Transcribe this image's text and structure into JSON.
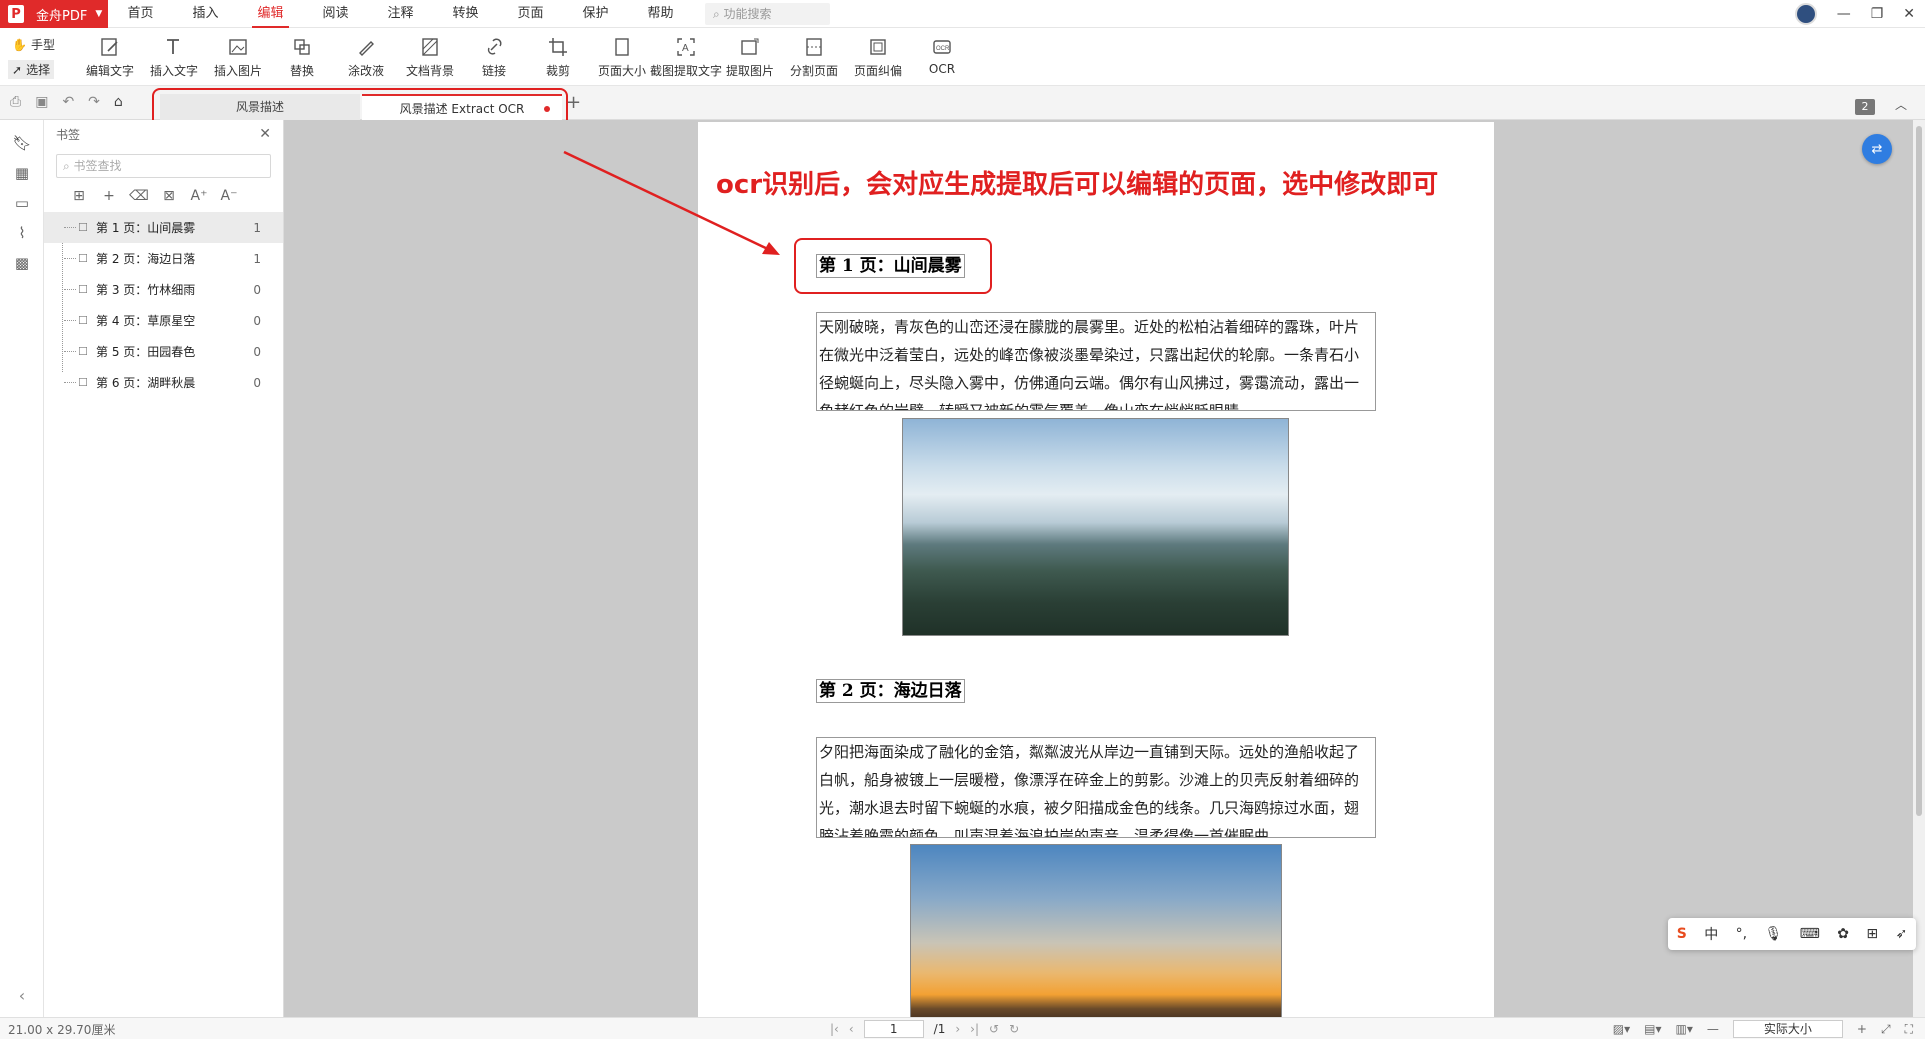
{
  "app": {
    "brand": "金舟PDF"
  },
  "menu": [
    "首页",
    "插入",
    "编辑",
    "阅读",
    "注释",
    "转换",
    "页面",
    "保护",
    "帮助"
  ],
  "menu_active": "编辑",
  "search": {
    "placeholder": "功能搜索"
  },
  "modes": {
    "hand": "手型",
    "select": "选择"
  },
  "tools": [
    "编辑文字",
    "插入文字",
    "插入图片",
    "替换",
    "涂改液",
    "文档背景",
    "链接",
    "裁剪",
    "页面大小",
    "截图提取文字",
    "提取图片",
    "分割页面",
    "页面纠偏",
    "OCR"
  ],
  "tabs": [
    "风景描述",
    "风景描述 Extract OCR"
  ],
  "page_count": "2",
  "panel": {
    "title": "书签",
    "search_placeholder": "书签查找",
    "bookmarks": [
      {
        "label": "第 1 页：山间晨雾",
        "count": "1"
      },
      {
        "label": "第 2 页：海边日落",
        "count": "1"
      },
      {
        "label": "第 3 页：竹林细雨",
        "count": "0"
      },
      {
        "label": "第 4 页：草原星空",
        "count": "0"
      },
      {
        "label": "第 5 页：田园春色",
        "count": "0"
      },
      {
        "label": "第 6 页：湖畔秋晨",
        "count": "0"
      }
    ]
  },
  "document": {
    "annotation": "ocr识别后，会对应生成提取后可以编辑的页面，选中修改即可",
    "heading1": "第 1 页：山间晨雾",
    "para1": "天刚破晓，青灰色的山峦还浸在朦胧的晨雾里。近处的松柏沾着细碎的露珠，叶片在微光中泛着莹白，远处的峰峦像被淡墨晕染过，只露出起伏的轮廓。一条青石小径蜿蜒向上，尽头隐入雾中，仿佛通向云端。偶尔有山风拂过，雾霭流动，露出一角赭红色的岩壁，转瞬又被新的雾气覆盖，像山峦在悄悄眨眼睛。",
    "heading2": "第 2 页：海边日落",
    "para2": "夕阳把海面染成了融化的金箔，粼粼波光从岸边一直铺到天际。远处的渔船收起了白帆，船身被镀上一层暖橙，像漂浮在碎金上的剪影。沙滩上的贝壳反射着细碎的光，潮水退去时留下蜿蜒的水痕，被夕阳描成金色的线条。几只海鸥掠过水面，翅膀沾着晚霞的颜色，叫声混着海浪拍岸的声音，温柔得像一首催眠曲。"
  },
  "status": {
    "paper_size": "21.00 x 29.70厘米",
    "page_input": "1",
    "page_total": "/1",
    "zoom": "实际大小"
  },
  "ime": {
    "lang": "中"
  },
  "colors": {
    "brand": "#e02a2a",
    "annotation": "#e02020"
  }
}
